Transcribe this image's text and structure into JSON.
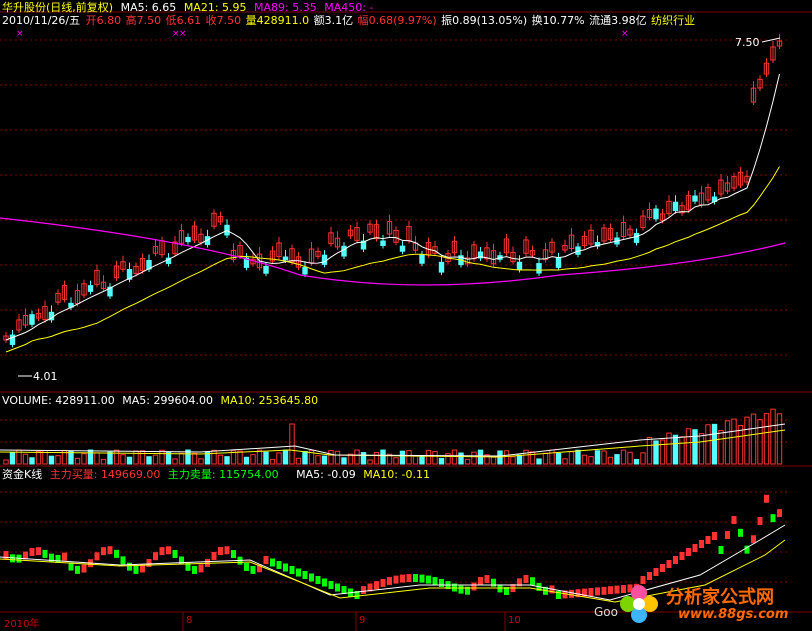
{
  "header": {
    "stock_name": "华升股份(日线,前复权)",
    "ma5": "MA5: 6.65",
    "ma21": "MA21: 5.95",
    "ma89": "MA89: 5.35",
    "ma450": "MA450: -",
    "date": "2010/11/26/五",
    "open": "开6.80",
    "high": "高7.50",
    "low": "低6.61",
    "close": "收7.50",
    "volume": "量428911.0",
    "amount": "额3.1亿",
    "change": "幅0.68(9.97%)",
    "amplitude": "振0.89(13.05%)",
    "turnover": "换10.77%",
    "float": "流通3.98亿",
    "industry": "纺织行业"
  },
  "price_panel": {
    "max_label": "7.50",
    "min_label": "4.01"
  },
  "volume_panel": {
    "volume": "VOLUME: 428911.00",
    "ma5": "MA5: 299604.00",
    "ma10": "MA10: 253645.80"
  },
  "fund_panel": {
    "title": "资金K线",
    "buy": "主力买量: 149669.00",
    "sell": "主力卖量: 115754.00",
    "ma5": "MA5: -0.09",
    "ma10": "MA10: -0.11"
  },
  "x_axis": {
    "labels": [
      "2010年",
      "8",
      "9",
      "10"
    ]
  },
  "watermark": {
    "site": "分析家公式网",
    "url": "www.88gs.com",
    "partial": "Goo"
  },
  "colors": {
    "up": "#ff3232",
    "down": "#54ffff",
    "ma5": "#ffffff",
    "ma21": "#ffff00",
    "ma89": "#ff00ff",
    "grid": "#800000"
  }
}
